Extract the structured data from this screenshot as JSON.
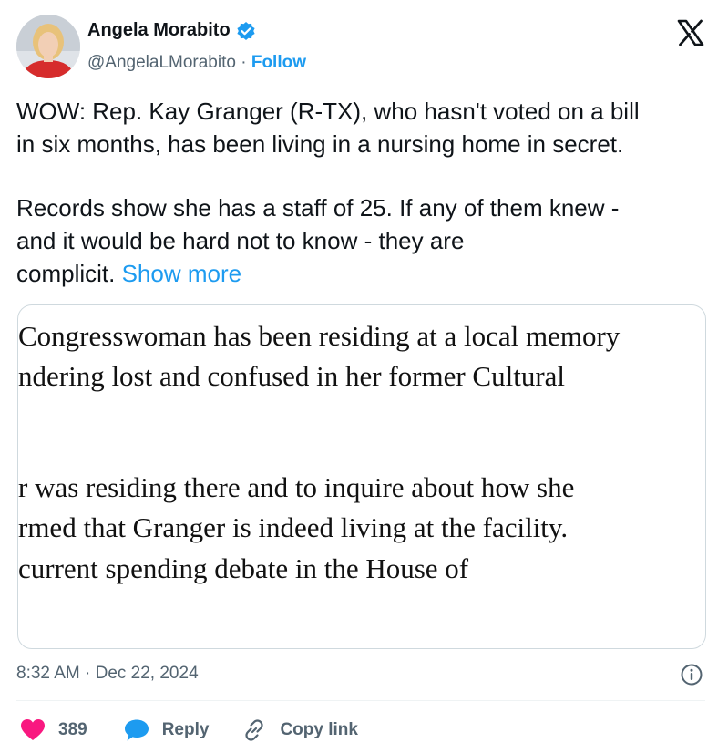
{
  "author": {
    "name": "Angela Morabito",
    "handle": "@AngelaLMorabito",
    "separator": "·",
    "follow_label": "Follow"
  },
  "icons": {
    "verified": "verified-badge-icon",
    "logo": "x-logo-icon",
    "info": "info-icon",
    "like": "heart-icon",
    "reply": "speech-bubble-icon",
    "copy": "link-icon"
  },
  "tweet": {
    "line1": "WOW: Rep. Kay Granger (R-TX), who hasn't voted on a bill",
    "line2": "in six months, has been living in a nursing home in secret.",
    "line3": "Records show she has a staff of 25. If any of them knew -",
    "line4": "and it would be hard not to know - they are",
    "line5": "complicit.",
    "show_more": "Show more"
  },
  "media_text": {
    "line1": "Congresswoman has been residing at a local memory",
    "line2": "ndering lost and confused in her former Cultural",
    "line3": "r was residing there and to inquire about how she",
    "line4": "rmed that Granger is indeed living at the facility.",
    "line5": "current spending debate in the House of"
  },
  "timestamp": {
    "time": "8:32 AM",
    "separator": "·",
    "date": "Dec 22, 2024"
  },
  "actions": {
    "likes_count": "389",
    "reply_label": "Reply",
    "copy_link_label": "Copy link"
  },
  "colors": {
    "accent": "#1d9bf0",
    "like": "#f91880",
    "text": "#0f1419",
    "muted": "#536471",
    "border": "#cfd9de"
  }
}
